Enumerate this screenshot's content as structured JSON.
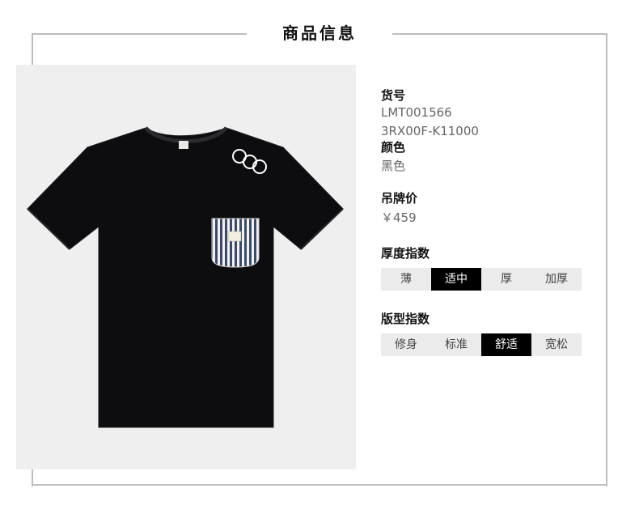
{
  "page_title": "商品信息",
  "details": {
    "item_no_label": "货号",
    "item_no_lines": [
      "LMT001566",
      "3RX00F-K11000"
    ],
    "color_label": "颜色",
    "color_value": "黑色",
    "price_label": "吊牌价",
    "price_value": "￥459"
  },
  "thickness": {
    "label": "厚度指数",
    "options": [
      "薄",
      "适中",
      "厚",
      "加厚"
    ],
    "selected": "适中"
  },
  "fit": {
    "label": "版型指数",
    "options": [
      "修身",
      "标准",
      "舒适",
      "宽松"
    ],
    "selected": "舒适"
  },
  "colors": {
    "frame": "#bdbdbd",
    "photo_bg": "#efefef",
    "shirt": "#0d0d0f",
    "selected_bg": "#000000",
    "unselected_bg": "#ebebeb"
  }
}
